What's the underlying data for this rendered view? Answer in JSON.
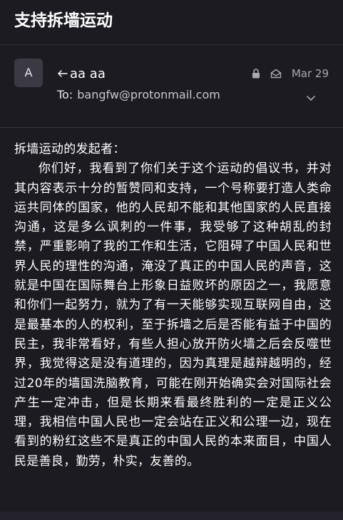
{
  "message": {
    "subject": "支持拆墙运动",
    "sender": {
      "avatar_letter": "A",
      "name": "aa aa",
      "reply_icon": "reply-arrow-icon"
    },
    "recipient": {
      "to_label": "To:",
      "address": "bangfw@protonmail.com"
    },
    "meta": {
      "lock_icon": "lock-icon",
      "envelope_icon": "envelope-open-icon",
      "date": "Mar 29",
      "expand_icon": "chevron-down-icon"
    },
    "body": {
      "greeting": "拆墙运动的发起者：",
      "paragraph": "你们好，我看到了你们关于这个运动的倡议书，并对其内容表示十分的暂赞同和支持，一个号称要打造人类命运共同体的国家，他的人民却不能和其他国家的人民直接沟通，这是多么讽刺的一件事，我受够了这种胡乱的封禁，严重影响了我的工作和生活，它阻碍了中国人民和世界人民的理性的沟通，淹没了真正的中国人民的声音，这就是中国在国际舞台上形象日益败坏的原因之一，我愿意和你们一起努力，就为了有一天能够实现互联网自由，这是最基本的人的权利，至于拆墙之后是否能有益于中国的民主，我非常看好，有些人担心放开防火墙之后会反噬世界，我觉得这是没有道理的，因为真理是越辩越明的，经过20年的墙国洗脑教育，可能在刚开始确实会对国际社会产生一定冲击，但是长期来看最终胜利的一定是正义公理，我相信中国人民也一定会站在正义和公理一边，现在看到的粉红这些不是真正的中国人民的本来面目，中国人民是善良，勤劳，朴实，友善的。"
    }
  },
  "colors": {
    "background": "#1c1b22",
    "avatar_bg": "#3b3a44",
    "muted_text": "#a9a8b1"
  }
}
